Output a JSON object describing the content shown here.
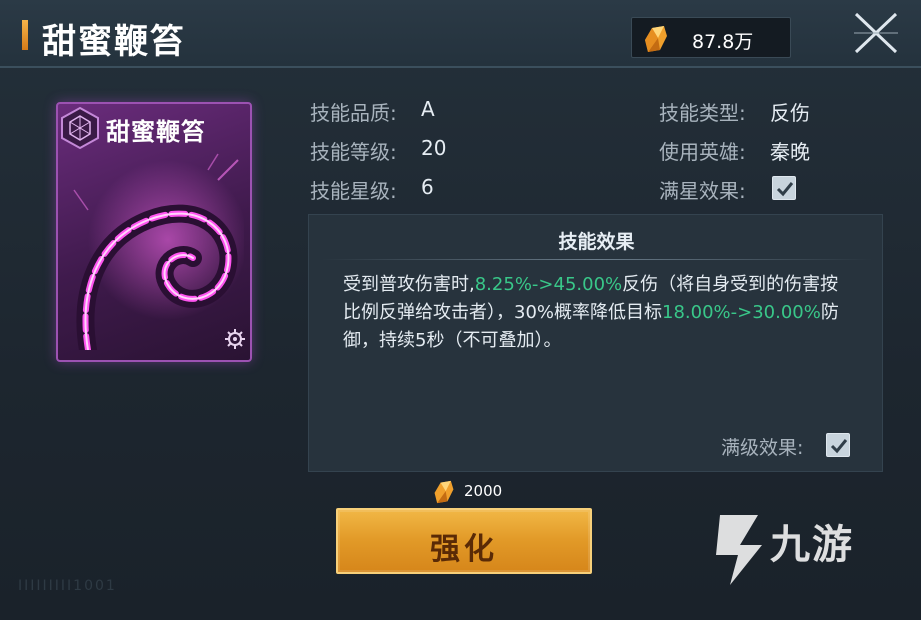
{
  "header": {
    "title": "甜蜜鞭笞",
    "currency_value": "87.8万",
    "currency_icon": "crystal-icon",
    "close_icon": "close-icon"
  },
  "card": {
    "title": "甜蜜鞭笞",
    "emblem_icon": "hexagon-emblem-icon",
    "settings_icon": "gear-icon",
    "rarity_color": "#9c52b2"
  },
  "info": {
    "quality_label": "技能品质:",
    "quality_value": "A",
    "level_label": "技能等级:",
    "level_value": "20",
    "star_label": "技能星级:",
    "star_value": "6",
    "type_label": "技能类型:",
    "type_value": "反伤",
    "hero_label": "使用英雄:",
    "hero_value": "秦晚",
    "fullstar_label": "满星效果:",
    "fullstar_checked": true
  },
  "effect": {
    "title": "技能效果",
    "text_1": "受到普攻伤害时,",
    "value_1": "8.25%->45.00%",
    "text_2": "反伤（将自身受到的伤害按比例反弹给攻击者），30%概率降低目标",
    "value_2": "18.00%->30.00%",
    "text_3": "防御，持续5秒（不可叠加）。",
    "maxlevel_label": "满级效果:",
    "maxlevel_checked": true,
    "highlight_color": "#39c789"
  },
  "enhance": {
    "cost": "2000",
    "button_label": "强化"
  },
  "watermark": {
    "text": "九游"
  },
  "footer": {
    "text": "IIIIIIIII1001"
  }
}
